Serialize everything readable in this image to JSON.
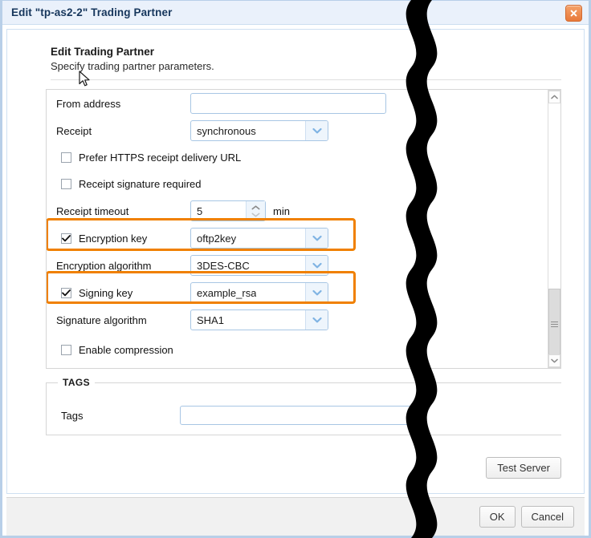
{
  "window": {
    "title": "Edit \"tp-as2-2\" Trading Partner",
    "close_icon": "close-icon"
  },
  "heading": {
    "title": "Edit Trading Partner",
    "subtitle": "Specify trading partner parameters."
  },
  "form": {
    "rows": [
      {
        "id": "from-address",
        "type": "text",
        "label": "From address",
        "value": "",
        "placeholder": ""
      },
      {
        "id": "receipt",
        "type": "select",
        "label": "Receipt",
        "value": "synchronous"
      },
      {
        "id": "prefer-https-receipt-delivery-url",
        "type": "checkbox",
        "label": "Prefer HTTPS receipt delivery URL",
        "checked": false
      },
      {
        "id": "receipt-signature-required",
        "type": "checkbox",
        "label": "Receipt signature required",
        "checked": false
      },
      {
        "id": "receipt-timeout",
        "type": "spinner",
        "label": "Receipt timeout",
        "value": "5",
        "unit": "min"
      },
      {
        "id": "encryption-key",
        "type": "checkbox-select",
        "label": "Encryption key",
        "checked": true,
        "value": "oftp2key",
        "highlighted": true
      },
      {
        "id": "encryption-algorithm",
        "type": "select",
        "label": "Encryption algorithm",
        "value": "3DES-CBC"
      },
      {
        "id": "signing-key",
        "type": "checkbox-select",
        "label": "Signing key",
        "checked": true,
        "value": "example_rsa",
        "highlighted": true
      },
      {
        "id": "signature-algorithm",
        "type": "select",
        "label": "Signature algorithm",
        "value": "SHA1"
      },
      {
        "id": "enable-compression",
        "type": "checkbox",
        "label": "Enable compression",
        "checked": false
      }
    ]
  },
  "tags_section": {
    "legend": "TAGS",
    "tags_label": "Tags",
    "tags_value": "",
    "tags_placeholder": ""
  },
  "actions": {
    "test_server": "Test Server",
    "ok": "OK",
    "cancel": "Cancel"
  },
  "scrollbar": {
    "up_icon": "chevron-up-icon",
    "down_icon": "chevron-down-icon"
  },
  "colors": {
    "highlight": "#f08000",
    "title_text": "#16365c",
    "titlebar_bg": "#eaf1fb",
    "input_border": "#a8c6e4",
    "close_button": "#e8793a"
  }
}
